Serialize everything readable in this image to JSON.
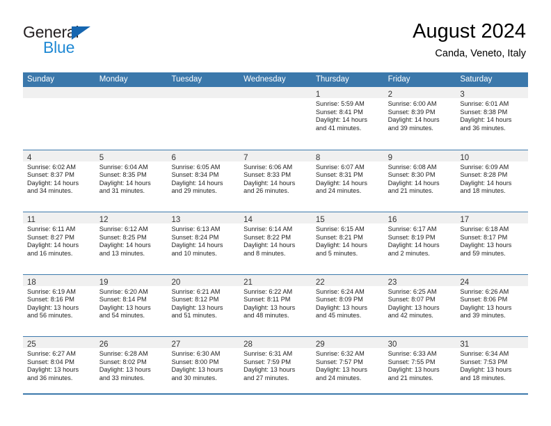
{
  "brand": {
    "name_line1": "General",
    "name_line2": "Blue",
    "primary_color": "#2089d4",
    "dark_color": "#231f20",
    "triangle_color": "#1666b0"
  },
  "header": {
    "title": "August 2024",
    "location": "Canda, Veneto, Italy"
  },
  "calendar": {
    "header_color": "#3b78ab",
    "day_band_color": "#f0f0f0",
    "weekdays": [
      "Sunday",
      "Monday",
      "Tuesday",
      "Wednesday",
      "Thursday",
      "Friday",
      "Saturday"
    ],
    "weeks": [
      [
        {
          "day": "",
          "sunrise": "",
          "sunset": "",
          "daylight_line1": "",
          "daylight_line2": ""
        },
        {
          "day": "",
          "sunrise": "",
          "sunset": "",
          "daylight_line1": "",
          "daylight_line2": ""
        },
        {
          "day": "",
          "sunrise": "",
          "sunset": "",
          "daylight_line1": "",
          "daylight_line2": ""
        },
        {
          "day": "",
          "sunrise": "",
          "sunset": "",
          "daylight_line1": "",
          "daylight_line2": ""
        },
        {
          "day": "1",
          "sunrise": "Sunrise: 5:59 AM",
          "sunset": "Sunset: 8:41 PM",
          "daylight_line1": "Daylight: 14 hours",
          "daylight_line2": "and 41 minutes."
        },
        {
          "day": "2",
          "sunrise": "Sunrise: 6:00 AM",
          "sunset": "Sunset: 8:39 PM",
          "daylight_line1": "Daylight: 14 hours",
          "daylight_line2": "and 39 minutes."
        },
        {
          "day": "3",
          "sunrise": "Sunrise: 6:01 AM",
          "sunset": "Sunset: 8:38 PM",
          "daylight_line1": "Daylight: 14 hours",
          "daylight_line2": "and 36 minutes."
        }
      ],
      [
        {
          "day": "4",
          "sunrise": "Sunrise: 6:02 AM",
          "sunset": "Sunset: 8:37 PM",
          "daylight_line1": "Daylight: 14 hours",
          "daylight_line2": "and 34 minutes."
        },
        {
          "day": "5",
          "sunrise": "Sunrise: 6:04 AM",
          "sunset": "Sunset: 8:35 PM",
          "daylight_line1": "Daylight: 14 hours",
          "daylight_line2": "and 31 minutes."
        },
        {
          "day": "6",
          "sunrise": "Sunrise: 6:05 AM",
          "sunset": "Sunset: 8:34 PM",
          "daylight_line1": "Daylight: 14 hours",
          "daylight_line2": "and 29 minutes."
        },
        {
          "day": "7",
          "sunrise": "Sunrise: 6:06 AM",
          "sunset": "Sunset: 8:33 PM",
          "daylight_line1": "Daylight: 14 hours",
          "daylight_line2": "and 26 minutes."
        },
        {
          "day": "8",
          "sunrise": "Sunrise: 6:07 AM",
          "sunset": "Sunset: 8:31 PM",
          "daylight_line1": "Daylight: 14 hours",
          "daylight_line2": "and 24 minutes."
        },
        {
          "day": "9",
          "sunrise": "Sunrise: 6:08 AM",
          "sunset": "Sunset: 8:30 PM",
          "daylight_line1": "Daylight: 14 hours",
          "daylight_line2": "and 21 minutes."
        },
        {
          "day": "10",
          "sunrise": "Sunrise: 6:09 AM",
          "sunset": "Sunset: 8:28 PM",
          "daylight_line1": "Daylight: 14 hours",
          "daylight_line2": "and 18 minutes."
        }
      ],
      [
        {
          "day": "11",
          "sunrise": "Sunrise: 6:11 AM",
          "sunset": "Sunset: 8:27 PM",
          "daylight_line1": "Daylight: 14 hours",
          "daylight_line2": "and 16 minutes."
        },
        {
          "day": "12",
          "sunrise": "Sunrise: 6:12 AM",
          "sunset": "Sunset: 8:25 PM",
          "daylight_line1": "Daylight: 14 hours",
          "daylight_line2": "and 13 minutes."
        },
        {
          "day": "13",
          "sunrise": "Sunrise: 6:13 AM",
          "sunset": "Sunset: 8:24 PM",
          "daylight_line1": "Daylight: 14 hours",
          "daylight_line2": "and 10 minutes."
        },
        {
          "day": "14",
          "sunrise": "Sunrise: 6:14 AM",
          "sunset": "Sunset: 8:22 PM",
          "daylight_line1": "Daylight: 14 hours",
          "daylight_line2": "and 8 minutes."
        },
        {
          "day": "15",
          "sunrise": "Sunrise: 6:15 AM",
          "sunset": "Sunset: 8:21 PM",
          "daylight_line1": "Daylight: 14 hours",
          "daylight_line2": "and 5 minutes."
        },
        {
          "day": "16",
          "sunrise": "Sunrise: 6:17 AM",
          "sunset": "Sunset: 8:19 PM",
          "daylight_line1": "Daylight: 14 hours",
          "daylight_line2": "and 2 minutes."
        },
        {
          "day": "17",
          "sunrise": "Sunrise: 6:18 AM",
          "sunset": "Sunset: 8:17 PM",
          "daylight_line1": "Daylight: 13 hours",
          "daylight_line2": "and 59 minutes."
        }
      ],
      [
        {
          "day": "18",
          "sunrise": "Sunrise: 6:19 AM",
          "sunset": "Sunset: 8:16 PM",
          "daylight_line1": "Daylight: 13 hours",
          "daylight_line2": "and 56 minutes."
        },
        {
          "day": "19",
          "sunrise": "Sunrise: 6:20 AM",
          "sunset": "Sunset: 8:14 PM",
          "daylight_line1": "Daylight: 13 hours",
          "daylight_line2": "and 54 minutes."
        },
        {
          "day": "20",
          "sunrise": "Sunrise: 6:21 AM",
          "sunset": "Sunset: 8:12 PM",
          "daylight_line1": "Daylight: 13 hours",
          "daylight_line2": "and 51 minutes."
        },
        {
          "day": "21",
          "sunrise": "Sunrise: 6:22 AM",
          "sunset": "Sunset: 8:11 PM",
          "daylight_line1": "Daylight: 13 hours",
          "daylight_line2": "and 48 minutes."
        },
        {
          "day": "22",
          "sunrise": "Sunrise: 6:24 AM",
          "sunset": "Sunset: 8:09 PM",
          "daylight_line1": "Daylight: 13 hours",
          "daylight_line2": "and 45 minutes."
        },
        {
          "day": "23",
          "sunrise": "Sunrise: 6:25 AM",
          "sunset": "Sunset: 8:07 PM",
          "daylight_line1": "Daylight: 13 hours",
          "daylight_line2": "and 42 minutes."
        },
        {
          "day": "24",
          "sunrise": "Sunrise: 6:26 AM",
          "sunset": "Sunset: 8:06 PM",
          "daylight_line1": "Daylight: 13 hours",
          "daylight_line2": "and 39 minutes."
        }
      ],
      [
        {
          "day": "25",
          "sunrise": "Sunrise: 6:27 AM",
          "sunset": "Sunset: 8:04 PM",
          "daylight_line1": "Daylight: 13 hours",
          "daylight_line2": "and 36 minutes."
        },
        {
          "day": "26",
          "sunrise": "Sunrise: 6:28 AM",
          "sunset": "Sunset: 8:02 PM",
          "daylight_line1": "Daylight: 13 hours",
          "daylight_line2": "and 33 minutes."
        },
        {
          "day": "27",
          "sunrise": "Sunrise: 6:30 AM",
          "sunset": "Sunset: 8:00 PM",
          "daylight_line1": "Daylight: 13 hours",
          "daylight_line2": "and 30 minutes."
        },
        {
          "day": "28",
          "sunrise": "Sunrise: 6:31 AM",
          "sunset": "Sunset: 7:59 PM",
          "daylight_line1": "Daylight: 13 hours",
          "daylight_line2": "and 27 minutes."
        },
        {
          "day": "29",
          "sunrise": "Sunrise: 6:32 AM",
          "sunset": "Sunset: 7:57 PM",
          "daylight_line1": "Daylight: 13 hours",
          "daylight_line2": "and 24 minutes."
        },
        {
          "day": "30",
          "sunrise": "Sunrise: 6:33 AM",
          "sunset": "Sunset: 7:55 PM",
          "daylight_line1": "Daylight: 13 hours",
          "daylight_line2": "and 21 minutes."
        },
        {
          "day": "31",
          "sunrise": "Sunrise: 6:34 AM",
          "sunset": "Sunset: 7:53 PM",
          "daylight_line1": "Daylight: 13 hours",
          "daylight_line2": "and 18 minutes."
        }
      ]
    ]
  }
}
